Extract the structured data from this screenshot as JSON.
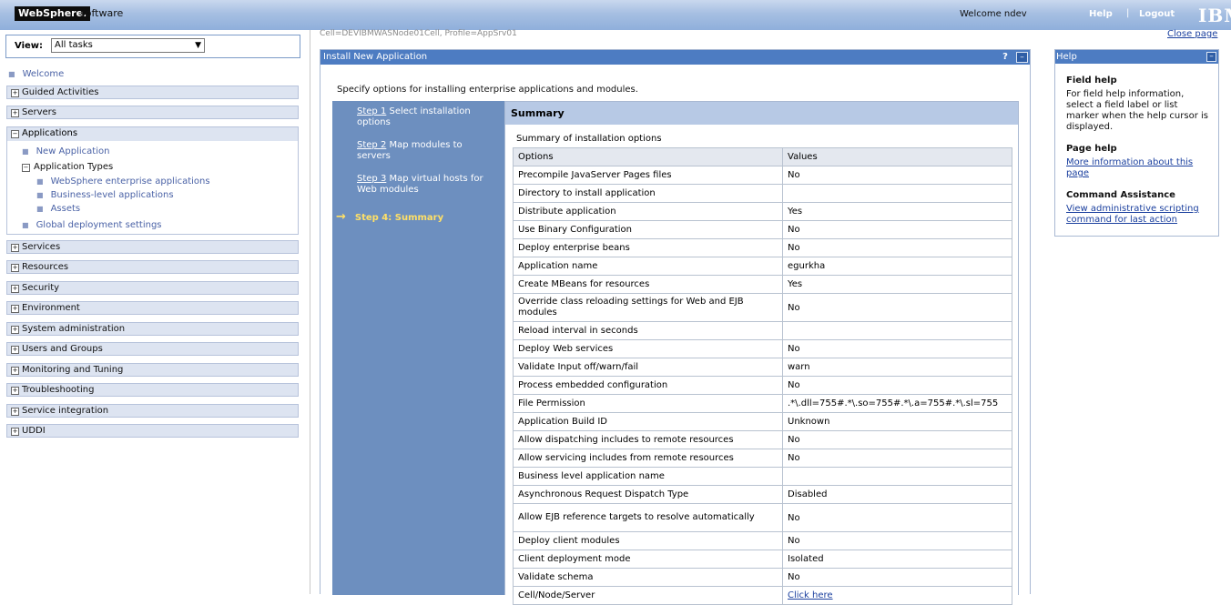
{
  "banner": {
    "brand": "WebSphere.",
    "brand_suffix": "software",
    "welcome": "Welcome ndev",
    "help": "Help",
    "separator": "|",
    "logout": "Logout",
    "logo": "IBM"
  },
  "nav": {
    "view_label": "View:",
    "view_value": "All tasks",
    "welcome": "Welcome",
    "categories_top": [
      "Guided Activities",
      "Servers"
    ],
    "applications": {
      "label": "Applications",
      "new_application": "New Application",
      "application_types": "Application Types",
      "types": [
        "WebSphere enterprise applications",
        "Business-level applications",
        "Assets"
      ],
      "global_deployment": "Global deployment settings"
    },
    "categories_bottom": [
      "Services",
      "Resources",
      "Security",
      "Environment",
      "System administration",
      "Users and Groups",
      "Monitoring and Tuning",
      "Troubleshooting",
      "Service integration",
      "UDDI"
    ]
  },
  "context": {
    "cell_profile": "Cell=DEVIBMWASNode01Cell, Profile=AppSrv01",
    "close_page": "Close page"
  },
  "panel": {
    "title": "Install New Application",
    "help_q": "?",
    "minimize": "–",
    "intro": "Specify options for installing enterprise applications and modules.",
    "steps": [
      {
        "link": "Step 1",
        "text": " Select installation options"
      },
      {
        "link": "Step 2",
        "text": " Map modules to servers"
      },
      {
        "link": "Step 3",
        "text": " Map virtual hosts for Web modules"
      }
    ],
    "current_step": "Step 4: Summary",
    "summary_title": "Summary",
    "summary_caption": "Summary of installation options",
    "table_headers": [
      "Options",
      "Values"
    ],
    "rows": [
      [
        "Precompile JavaServer Pages files",
        "No"
      ],
      [
        "Directory to install application",
        ""
      ],
      [
        "Distribute application",
        "Yes"
      ],
      [
        "Use Binary Configuration",
        "No"
      ],
      [
        "Deploy enterprise beans",
        "No"
      ],
      [
        "Application name",
        "egurkha"
      ],
      [
        "Create MBeans for resources",
        "Yes"
      ],
      [
        "Override class reloading settings for Web and EJB modules",
        "No"
      ],
      [
        "Reload interval in seconds",
        ""
      ],
      [
        "Deploy Web services",
        "No"
      ],
      [
        "Validate Input off/warn/fail",
        "warn"
      ],
      [
        "Process embedded configuration",
        "No"
      ],
      [
        "File Permission",
        ".*\\.dll=755#.*\\.so=755#.*\\.a=755#.*\\.sl=755"
      ],
      [
        "Application Build ID",
        "Unknown"
      ],
      [
        "Allow dispatching includes to remote resources",
        "No"
      ],
      [
        "Allow servicing includes from remote resources",
        "No"
      ],
      [
        "Business level application name",
        ""
      ],
      [
        "Asynchronous Request Dispatch Type",
        "Disabled"
      ],
      [
        "Allow EJB reference targets to resolve automatically",
        "No"
      ],
      [
        "Deploy client modules",
        "No"
      ],
      [
        "Client deployment mode",
        "Isolated"
      ],
      [
        "Validate schema",
        "No"
      ],
      [
        "Cell/Node/Server",
        "Click here"
      ]
    ]
  },
  "help": {
    "title": "Help",
    "minimize": "–",
    "field_help_title": "Field help",
    "field_help_text": "For field help information, select a field label or list marker when the help cursor is displayed.",
    "page_help_title": "Page help",
    "page_help_link": "More information about this page",
    "command_title": "Command Assistance",
    "command_link": "View administrative scripting command for last action"
  }
}
